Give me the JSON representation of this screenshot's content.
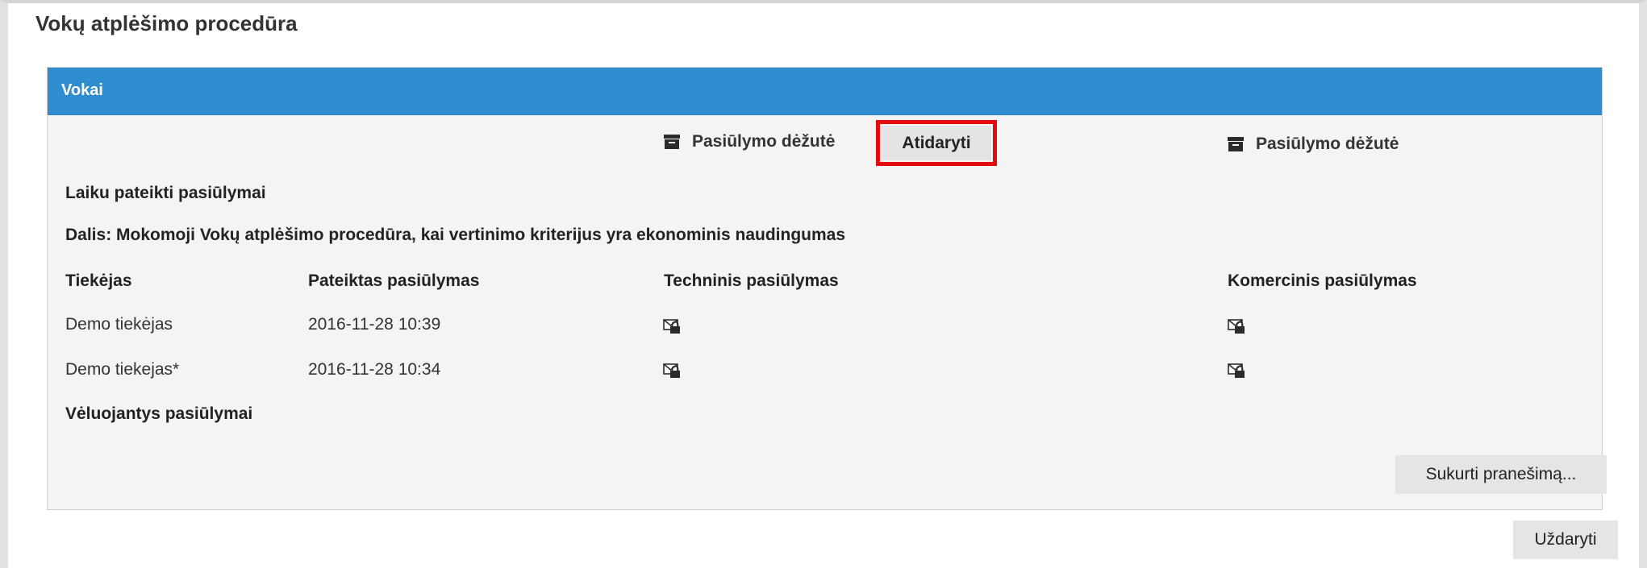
{
  "page_title": "Vokų atplėšimo procedūra",
  "panel": {
    "title": "Vokai",
    "box_left_label": "Pasiūlymo dėžutė",
    "open_button": "Atidaryti",
    "box_right_label": "Pasiūlymo dėžutė"
  },
  "sections": {
    "on_time": "Laiku pateikti pasiūlymai",
    "part": "Dalis: Mokomoji Vokų atplėšimo procedūra, kai vertinimo kriterijus yra ekonominis naudingumas",
    "late": "Vėluojantys pasiūlymai"
  },
  "table": {
    "columns": [
      "Tiekėjas",
      "Pateiktas pasiūlymas",
      "Techninis pasiūlymas",
      "Komercinis pasiūlymas"
    ],
    "rows": [
      {
        "supplier": "Demo tiekėjas",
        "submitted": "2016-11-28 10:39"
      },
      {
        "supplier": "Demo tiekejas*",
        "submitted": "2016-11-28 10:34"
      }
    ]
  },
  "buttons": {
    "create_message": "Sukurti pranešimą...",
    "close": "Uždaryti"
  },
  "colors": {
    "header_blue": "#2f8cce",
    "highlight_red": "#e30b0b",
    "panel_bg": "#f4f4f4"
  },
  "icons": {
    "box": "archive-box-icon",
    "envelope": "locked-envelope-icon"
  }
}
